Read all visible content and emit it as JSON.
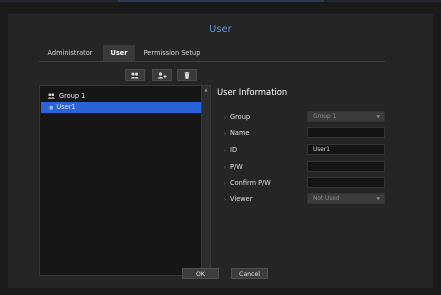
{
  "window": {
    "title": "User"
  },
  "tabs": [
    {
      "label": "Administrator",
      "active": false
    },
    {
      "label": "User",
      "active": true
    },
    {
      "label": "Permission Setup",
      "active": false
    }
  ],
  "toolbar": {
    "icons": [
      "add-group-icon",
      "add-user-icon",
      "delete-icon"
    ]
  },
  "tree": {
    "group": {
      "label": "Group 1",
      "icon": "group-icon"
    },
    "user": {
      "label": "User1"
    }
  },
  "info": {
    "title": "User Information",
    "fields": {
      "group": {
        "label": "Group",
        "value": "Group 1"
      },
      "name": {
        "label": "Name",
        "value": ""
      },
      "id": {
        "label": "ID",
        "value": "User1"
      },
      "pw": {
        "label": "P/W",
        "value": ""
      },
      "confirm_pw": {
        "label": "Confirm P/W",
        "value": ""
      },
      "viewer": {
        "label": "Viewer",
        "value": "Not Used"
      }
    }
  },
  "footer": {
    "ok_label": "OK",
    "cancel_label": "Cancel"
  },
  "colors": {
    "title": "#5b9be6",
    "selection": "#2a63d9",
    "background": "#252525"
  }
}
